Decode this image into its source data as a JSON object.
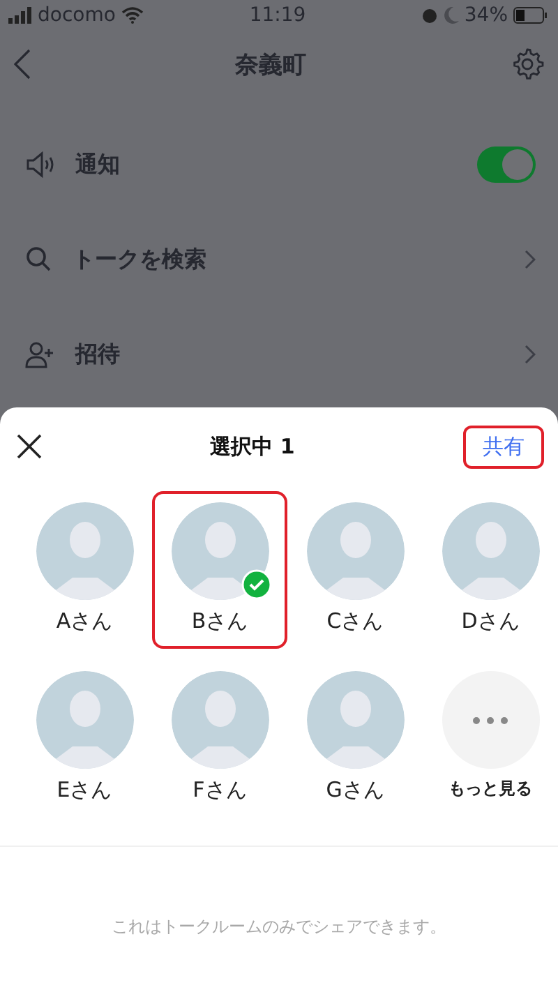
{
  "status_bar": {
    "carrier": "docomo",
    "time": "11:19",
    "battery": "34%"
  },
  "nav": {
    "title": "奈義町"
  },
  "settings": [
    {
      "kind": "toggle",
      "label": "通知",
      "on": true
    },
    {
      "kind": "link",
      "label": "トークを検索"
    },
    {
      "kind": "link",
      "label": "招待"
    }
  ],
  "sheet": {
    "title": "選択中 1",
    "share_button": {
      "label": "共有",
      "highlighted": true
    },
    "contacts": [
      {
        "kind": "person",
        "name": "Aさん",
        "selected": false,
        "highlighted": false
      },
      {
        "kind": "person",
        "name": "Bさん",
        "selected": true,
        "highlighted": true
      },
      {
        "kind": "person",
        "name": "Cさん",
        "selected": false,
        "highlighted": false
      },
      {
        "kind": "person",
        "name": "Dさん",
        "selected": false,
        "highlighted": false
      },
      {
        "kind": "person",
        "name": "Eさん",
        "selected": false,
        "highlighted": false
      },
      {
        "kind": "person",
        "name": "Fさん",
        "selected": false,
        "highlighted": false
      },
      {
        "kind": "person",
        "name": "Gさん",
        "selected": false,
        "highlighted": false
      },
      {
        "kind": "more",
        "name": "もっと見る"
      }
    ],
    "note": "これはトークルームのみでシェアできます。"
  }
}
